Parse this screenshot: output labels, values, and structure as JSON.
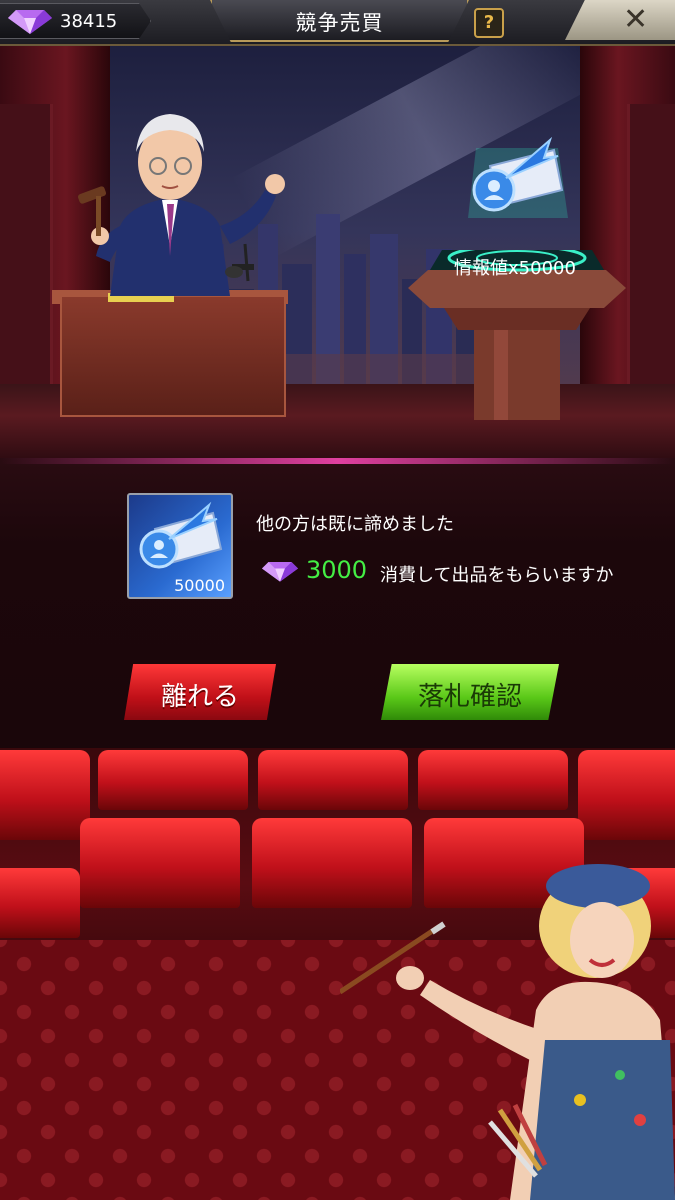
{
  "header": {
    "gem_count": "38415",
    "title": "競争売買",
    "help_label": "?",
    "close_label": "✕"
  },
  "stage": {
    "prize_label": "情報値x50000"
  },
  "dialog": {
    "item_quantity": "50000",
    "message_line1": "他の方は既に諦めました",
    "cost": "3000",
    "message_line2": "消費して出品をもらいますか"
  },
  "buttons": {
    "leave_label": "離れる",
    "confirm_label": "落札確認"
  },
  "colors": {
    "accent_gold": "#c9a04a",
    "cost_green": "#44ee44",
    "leave_red": "#c01018",
    "confirm_green": "#5ac818"
  },
  "icons": {
    "currency": "gem-icon",
    "item": "intel-ticket-icon"
  }
}
